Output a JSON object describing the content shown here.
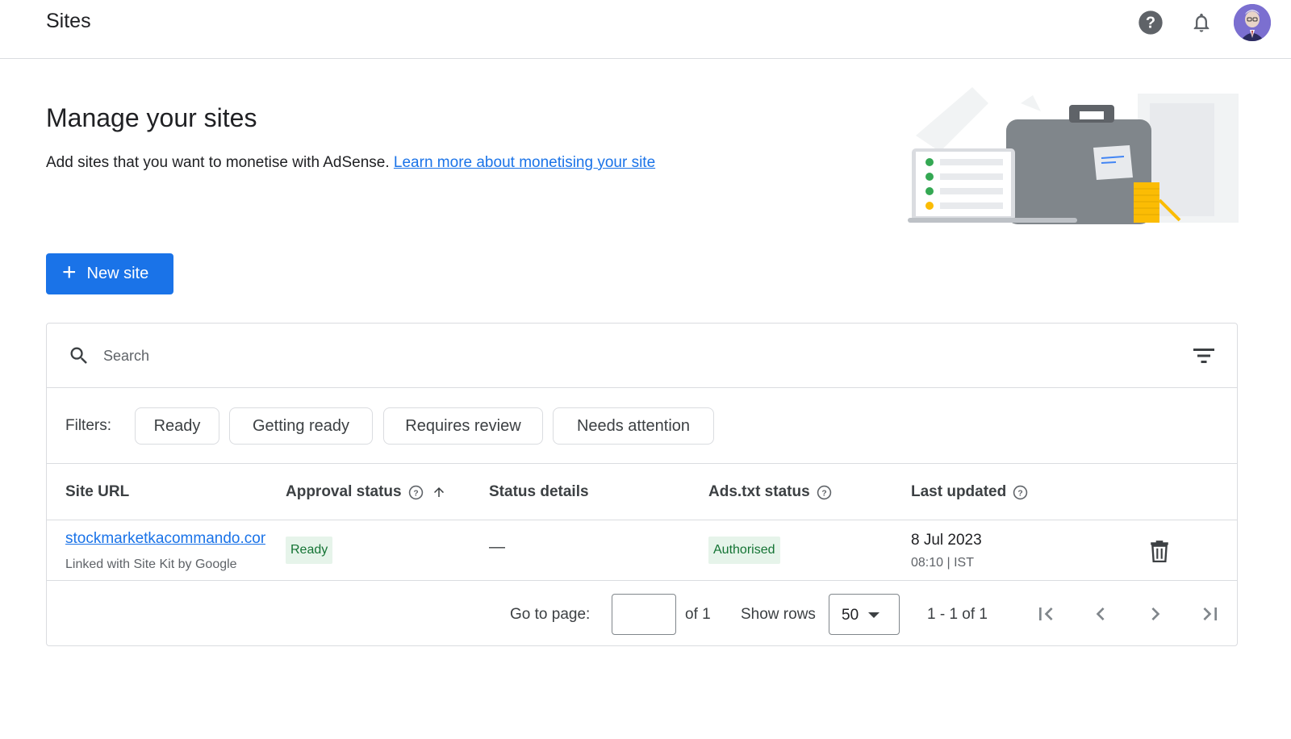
{
  "header": {
    "title": "Sites"
  },
  "hero": {
    "title": "Manage your sites",
    "description": "Add sites that you want to monetise with AdSense.",
    "link_text": "Learn more about monetising your site"
  },
  "actions": {
    "new_site_label": "New site"
  },
  "search": {
    "placeholder": "Search"
  },
  "filters": {
    "label": "Filters:",
    "chips": [
      "Ready",
      "Getting ready",
      "Requires review",
      "Needs attention"
    ]
  },
  "table": {
    "columns": [
      "Site URL",
      "Approval status",
      "Status details",
      "Ads.txt status",
      "Last updated"
    ],
    "rows": [
      {
        "site_url": "stockmarketkacommando.com",
        "site_sub": "Linked with Site Kit by Google",
        "approval_status": "Ready",
        "status_details": "—",
        "ads_txt_status": "Authorised",
        "date": "8 Jul 2023",
        "time": "08:10 | IST"
      }
    ]
  },
  "pagination": {
    "go_to_label": "Go to page:",
    "of_label": "of 1",
    "show_rows_label": "Show rows",
    "rows_value": "50",
    "range_text": "1 - 1 of 1"
  },
  "colors": {
    "primary": "#1a73e8",
    "status_bg": "#e6f4ea",
    "status_text": "#137333",
    "border": "#dadce0"
  },
  "icons": [
    "help-icon",
    "bell-icon",
    "avatar",
    "search-icon",
    "filter-icon",
    "help-circle-icon",
    "sort-up-arrow-icon",
    "trash-icon",
    "first-page-icon",
    "prev-page-icon",
    "next-page-icon",
    "last-page-icon",
    "plus-icon"
  ]
}
